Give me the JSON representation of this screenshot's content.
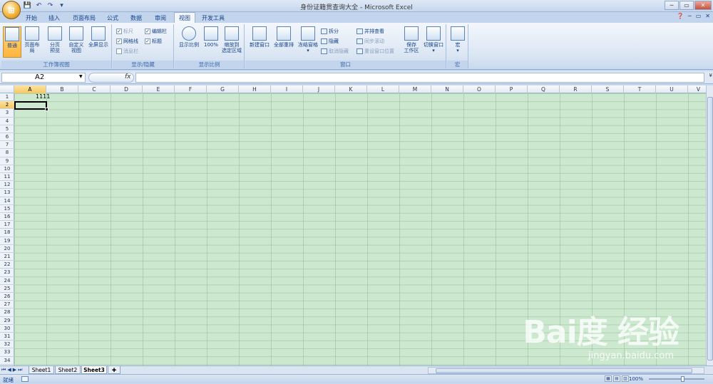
{
  "window": {
    "title": "身份证籍贯查询大全 - Microsoft Excel",
    "office_button": "⊞",
    "qat_blur": "",
    "buttons": [
      "─",
      "▭",
      "✕"
    ]
  },
  "tabs": [
    "开始",
    "插入",
    "页面布局",
    "公式",
    "数据",
    "审阅",
    "视图",
    "开发工具"
  ],
  "active_tab": "视图",
  "help": [
    "❓",
    "─",
    "▭",
    "✕"
  ],
  "ribbon": {
    "workbook_views": {
      "label": "工作簿视图",
      "normal": "普通",
      "page_layout": "页面布局",
      "page_break": "分页\n预览",
      "custom_views": "自定义\n视图",
      "full_screen": "全屏显示"
    },
    "show_hide": {
      "label": "显示/隐藏",
      "ruler": "标尺",
      "gridlines": "网格线",
      "message_bar": "消息栏",
      "formula_bar": "编辑栏",
      "headings": "标题"
    },
    "zoom": {
      "label": "显示比例",
      "zoom": "显示比例",
      "hundred": "100%",
      "zoom_selection": "缩放到\n选定区域"
    },
    "window": {
      "label": "窗口",
      "new_window": "新建窗口",
      "arrange_all": "全部重排",
      "freeze_panes": "冻结窗格",
      "split": "拆分",
      "hide": "隐藏",
      "unhide": "取消隐藏",
      "side_by_side": "并排查看",
      "sync_scroll": "同步滚动",
      "reset_position": "重设窗口位置",
      "save_workspace": "保存\n工作区",
      "switch_windows": "切换窗口"
    },
    "macros": {
      "label": "宏",
      "macros": "宏"
    }
  },
  "formula_bar": {
    "name_box": "A2",
    "fx": "fx",
    "formula": ""
  },
  "columns": [
    "A",
    "B",
    "C",
    "D",
    "E",
    "F",
    "G",
    "H",
    "I",
    "J",
    "K",
    "L",
    "M",
    "N",
    "O",
    "P",
    "Q",
    "R",
    "S",
    "T",
    "U",
    "V"
  ],
  "selected_column": "A",
  "rows": [
    "1",
    "2",
    "3",
    "4",
    "5",
    "6",
    "7",
    "8",
    "9",
    "10",
    "11",
    "12",
    "13",
    "14",
    "15",
    "16",
    "17",
    "18",
    "19",
    "20",
    "21",
    "22",
    "23",
    "24",
    "25",
    "26",
    "27",
    "28",
    "29",
    "30",
    "31",
    "32",
    "33",
    "34"
  ],
  "selected_row": "2",
  "cells": {
    "A1": "1111"
  },
  "sheets": [
    "Sheet1",
    "Sheet2",
    "Sheet3"
  ],
  "active_sheet": "Sheet3",
  "status": {
    "text": "就绪",
    "zoom": "100%"
  },
  "watermark": {
    "brand": "Bai度 经验",
    "url": "jingyan.baidu.com"
  }
}
